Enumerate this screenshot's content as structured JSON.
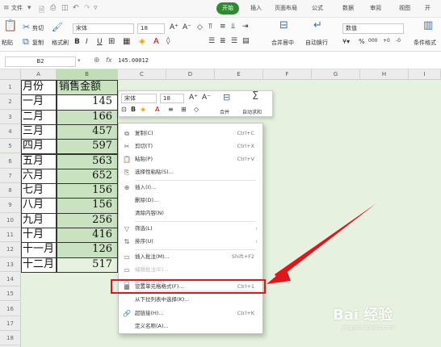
{
  "menubar": {
    "file": "文件",
    "tabs": [
      "开始",
      "插入",
      "页面布局",
      "公式",
      "数据",
      "审阅",
      "视图"
    ],
    "active_tab": "开始"
  },
  "ribbon": {
    "paste": "粘贴",
    "cut": "剪切",
    "copy": "复制",
    "format_painter": "格式刷",
    "font_name": "宋体",
    "font_size": "18",
    "bold": "B",
    "italic": "I",
    "underline": "U",
    "grow_font": "A⁺",
    "shrink_font": "A⁻",
    "merge_center": "合并居中",
    "wrap_text": "自动换行",
    "number_format": "数值",
    "percent": "%",
    "thousands": "000",
    "dec_up": "+0",
    "dec_down": "-0",
    "cond_format": "条件格式"
  },
  "formula_bar": {
    "name_box": "B2",
    "fx": "fx",
    "value": "145.00012"
  },
  "columns": [
    "A",
    "B",
    "C",
    "D",
    "E",
    "F",
    "G",
    "H",
    "I",
    "J"
  ],
  "rows": [
    "1",
    "2",
    "3",
    "4",
    "5",
    "6",
    "7",
    "8",
    "9",
    "10",
    "11",
    "12",
    "13",
    "14",
    "15",
    "16",
    "17",
    "18",
    "19"
  ],
  "table": {
    "header": {
      "a": "月份",
      "b": "销售金额"
    },
    "rows": [
      {
        "a": "一月",
        "b": "145"
      },
      {
        "a": "二月",
        "b": "166"
      },
      {
        "a": "三月",
        "b": "457"
      },
      {
        "a": "四月",
        "b": "597"
      },
      {
        "a": "五月",
        "b": "563"
      },
      {
        "a": "六月",
        "b": "652"
      },
      {
        "a": "七月",
        "b": "156"
      },
      {
        "a": "八月",
        "b": "156"
      },
      {
        "a": "九月",
        "b": "256"
      },
      {
        "a": "十月",
        "b": "416"
      },
      {
        "a": "十一月",
        "b": "126"
      },
      {
        "a": "十二月",
        "b": "517"
      }
    ]
  },
  "mini_toolbar": {
    "font": "宋体",
    "size": "18",
    "grow": "A⁺",
    "shrink": "A⁻",
    "merge": "合并",
    "autosum": "自动求和",
    "sum_sym": "Σ"
  },
  "context_menu": {
    "copy": {
      "label": "复制(C)",
      "shortcut": "Ctrl+C"
    },
    "cut": {
      "label": "剪切(T)",
      "shortcut": "Ctrl+X"
    },
    "paste": {
      "label": "粘贴(P)",
      "shortcut": "Ctrl+V"
    },
    "paste_special": {
      "label": "选择性粘贴(S)..."
    },
    "insert": {
      "label": "插入(I)..."
    },
    "delete": {
      "label": "删除(D)..."
    },
    "clear": {
      "label": "清除内容(N)"
    },
    "filter": {
      "label": "筛选(L)"
    },
    "sort": {
      "label": "排序(U)"
    },
    "insert_comment": {
      "label": "插入批注(M)...",
      "shortcut": "Shift+F2"
    },
    "edit_comment": {
      "label": "编辑批注(E)..."
    },
    "delete_comment": {
      "label": "删除批注(M)"
    },
    "format_cells": {
      "label": "设置单元格格式(F)...",
      "shortcut": "Ctrl+1"
    },
    "pick_list": {
      "label": "从下拉列表中选择(K)..."
    },
    "hyperlink": {
      "label": "超链接(H)...",
      "shortcut": "Ctrl+K"
    },
    "define_name": {
      "label": "定义名称(A)..."
    }
  },
  "watermark": {
    "text": "Bai 经验",
    "url": "jingyan.baidu.com"
  },
  "colors": {
    "highlight": "#e0161c",
    "selection": "#c9e3c1",
    "sheet_bg": "#e6f2df",
    "accent": "#2e8b2e"
  }
}
